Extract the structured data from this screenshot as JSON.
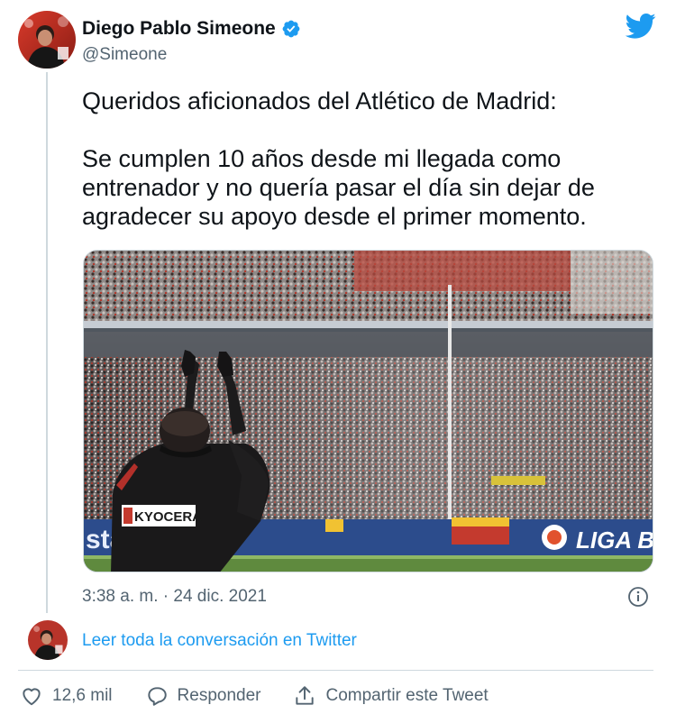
{
  "author": {
    "name": "Diego Pablo Simeone",
    "handle": "@Simeone",
    "verified": true
  },
  "tweet": {
    "paragraph1": "Queridos aficionados del Atlético de Madrid:",
    "paragraph2": "Se cumplen 10 años desde mi llegada como entrenador y no quería pasar el día sin dejar de agradecer su apoyo desde el primer momento.",
    "timestamp": "3:38 a. m. · 24 dic. 2021"
  },
  "photo": {
    "sponsor_text": "KYOCERA",
    "banner_text": "LIGA B",
    "stadium_text": "sta"
  },
  "conversation_link": "Leer toda la conversación en Twitter",
  "actions": {
    "likes": "12,6 mil",
    "reply": "Responder",
    "share": "Compartir este Tweet"
  },
  "colors": {
    "twitter_blue": "#1d9bf0",
    "muted_text": "#536471",
    "atletico_red": "#cb3524"
  },
  "icons": [
    "twitter-bird-icon",
    "verified-badge-icon",
    "info-icon",
    "heart-icon",
    "reply-icon",
    "share-icon"
  ]
}
